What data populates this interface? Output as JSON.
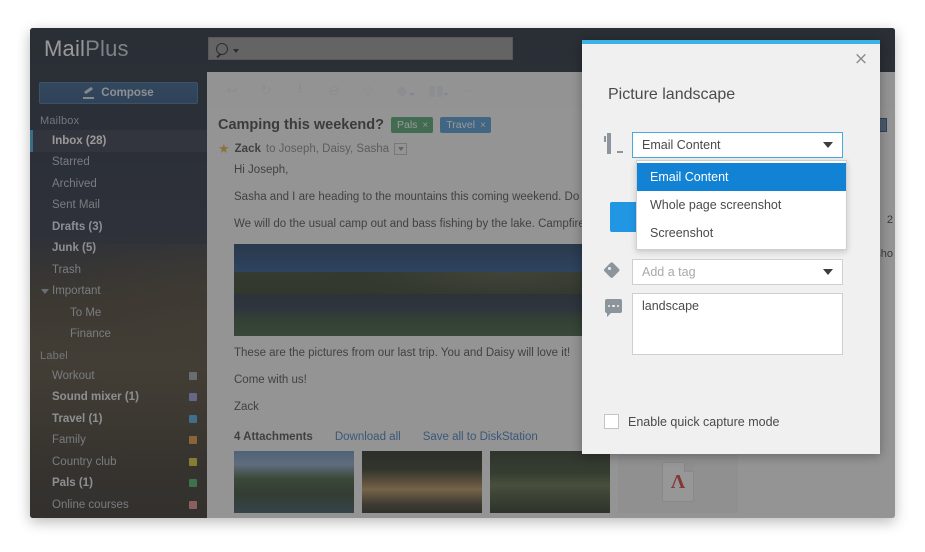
{
  "app": {
    "brand_main": "Mail",
    "brand_sub": "Plus",
    "search": {
      "placeholder": "",
      "value": "",
      "icon": "search-icon"
    }
  },
  "sidebar": {
    "compose_label": "Compose",
    "sections": [
      {
        "title": "Mailbox",
        "items": [
          {
            "label": "Inbox (28)",
            "state": "active",
            "indent": false,
            "twisty": false,
            "swatch": ""
          },
          {
            "label": "Starred",
            "state": "normal",
            "indent": false,
            "twisty": false,
            "swatch": ""
          },
          {
            "label": "Archived",
            "state": "normal",
            "indent": false,
            "twisty": false,
            "swatch": ""
          },
          {
            "label": "Sent Mail",
            "state": "normal",
            "indent": false,
            "twisty": false,
            "swatch": ""
          },
          {
            "label": "Drafts (3)",
            "state": "bold",
            "indent": false,
            "twisty": false,
            "swatch": ""
          },
          {
            "label": "Junk (5)",
            "state": "bold",
            "indent": false,
            "twisty": false,
            "swatch": ""
          },
          {
            "label": "Trash",
            "state": "normal",
            "indent": false,
            "twisty": false,
            "swatch": ""
          },
          {
            "label": "Important",
            "state": "normal",
            "indent": false,
            "twisty": true,
            "swatch": ""
          },
          {
            "label": "To Me",
            "state": "normal",
            "indent": true,
            "twisty": false,
            "swatch": ""
          },
          {
            "label": "Finance",
            "state": "normal",
            "indent": true,
            "twisty": false,
            "swatch": ""
          }
        ]
      },
      {
        "title": "Label",
        "items": [
          {
            "label": "Workout",
            "state": "normal",
            "indent": false,
            "twisty": false,
            "swatch": "#9aa0a6"
          },
          {
            "label": "Sound mixer (1)",
            "state": "bold",
            "indent": false,
            "twisty": false,
            "swatch": "#8f8fd6"
          },
          {
            "label": "Travel (1)",
            "state": "bold",
            "indent": false,
            "twisty": false,
            "swatch": "#3aa0e0"
          },
          {
            "label": "Family",
            "state": "normal",
            "indent": false,
            "twisty": false,
            "swatch": "#e08a2e"
          },
          {
            "label": "Country club",
            "state": "normal",
            "indent": false,
            "twisty": false,
            "swatch": "#d6c01f"
          },
          {
            "label": "Pals (1)",
            "state": "bold",
            "indent": false,
            "twisty": false,
            "swatch": "#34a853"
          },
          {
            "label": "Online courses",
            "state": "normal",
            "indent": false,
            "twisty": false,
            "swatch": "#d9807f"
          }
        ]
      }
    ]
  },
  "toolbar": {
    "buttons": [
      {
        "name": "reply-icon",
        "glyph": "↩",
        "caret": false
      },
      {
        "name": "refresh-icon",
        "glyph": "↻",
        "caret": false
      },
      {
        "name": "archive-icon",
        "glyph": "⭳",
        "caret": false
      },
      {
        "name": "spam-icon",
        "glyph": "⊖",
        "caret": false
      },
      {
        "name": "delete-icon",
        "glyph": "Ὕ1",
        "caret": false
      },
      {
        "name": "tag-icon",
        "glyph": "◆",
        "caret": true
      },
      {
        "name": "folder-icon",
        "glyph": "▬",
        "caret": true
      },
      {
        "name": "more-icon",
        "glyph": "···",
        "caret": false
      }
    ]
  },
  "email": {
    "subject": "Camping this weekend?",
    "chips": [
      {
        "label": "Pals",
        "color": "#3e9c5f",
        "close": "×"
      },
      {
        "label": "Travel",
        "color": "#3b8fd0",
        "close": "×"
      }
    ],
    "sender": "Zack",
    "recipients": "to Joseph, Daisy, Sasha",
    "greeting": "Hi Joseph,",
    "paragraph1": "Sasha and I are heading to the mountains this coming weekend. Do you want to",
    "paragraph2": "We will do the usual camp out and bass fishing by the lake. Campfire and s'mor tain. It's going to be a great relaxing weekend.",
    "paragraph3": "These are the pictures from our last trip. You and Daisy will love it!",
    "paragraph4": "Come with us!",
    "signature": "Zack",
    "attachments_count_label": "4 Attachments",
    "download_all_label": "Download all",
    "save_all_label": "Save all to DiskStation",
    "thumbnails": [
      {
        "name": "thumb-mountain-lake"
      },
      {
        "name": "thumb-smores"
      },
      {
        "name": "thumb-fish"
      },
      {
        "name": "thumb-pdf"
      }
    ]
  },
  "behind_panel": {
    "fragment_1": "2",
    "fragment_2": "sho"
  },
  "dialog": {
    "accent_color": "#39b3e6",
    "title": "Picture landscape",
    "close_glyph": "×",
    "content_select": {
      "value": "Email Content",
      "options": [
        "Email Content",
        "Whole page screenshot",
        "Screenshot"
      ],
      "selected_index": 0,
      "open": true
    },
    "tag_field": {
      "placeholder": "Add a tag",
      "value": ""
    },
    "comment_field": {
      "value": "landscape"
    },
    "quick_capture": {
      "label": "Enable quick capture mode",
      "checked": false
    }
  }
}
